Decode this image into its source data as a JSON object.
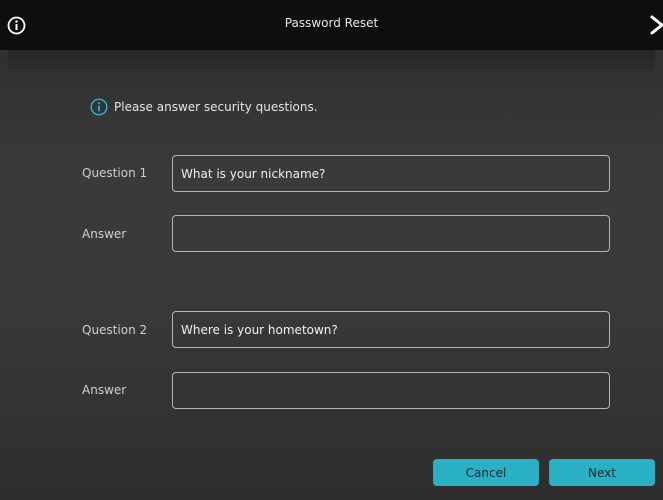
{
  "window": {
    "title": "Password Reset"
  },
  "icons": {
    "header_info": "info-icon",
    "close": "close-icon",
    "notice_info": "info-icon"
  },
  "colors": {
    "accent": "#2ab0c5",
    "titlebar": "#0e0e0e",
    "field_border": "#b4b4b4"
  },
  "notice": {
    "text": "Please answer security questions."
  },
  "questions": [
    {
      "question_label": "Question 1",
      "question_value": "What is your nickname?",
      "answer_label": "Answer",
      "answer_value": ""
    },
    {
      "question_label": "Question 2",
      "question_value": "Where is your hometown?",
      "answer_label": "Answer",
      "answer_value": ""
    }
  ],
  "buttons": {
    "cancel": "Cancel",
    "next": "Next"
  }
}
